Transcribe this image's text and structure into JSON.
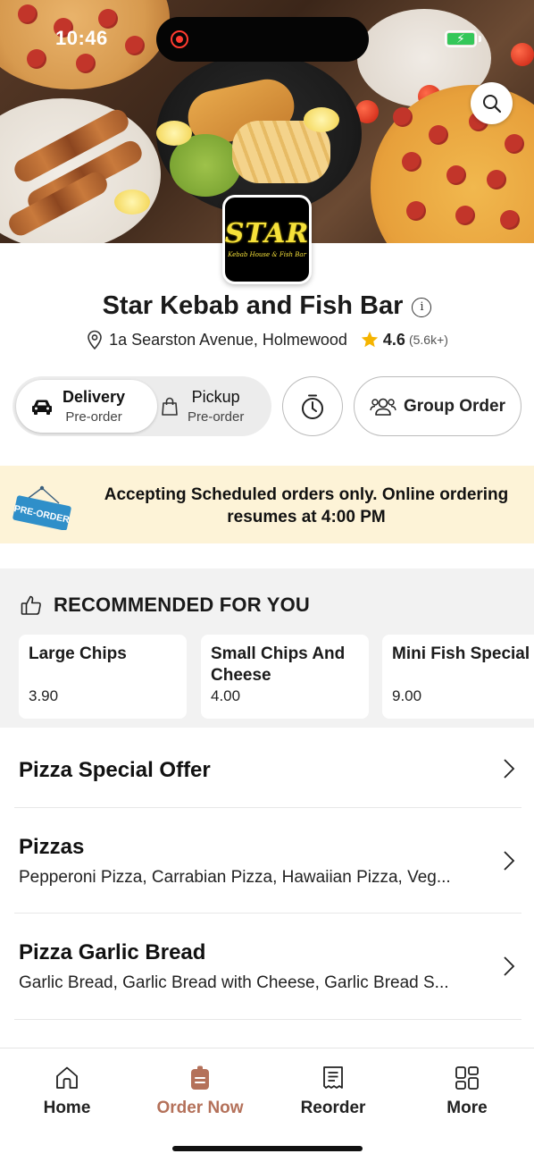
{
  "status_bar": {
    "time": "10:46"
  },
  "restaurant": {
    "logo_text": "STAR",
    "logo_tagline": "Kebab House & Fish Bar",
    "name": "Star Kebab and Fish Bar",
    "address": "1a Searston Avenue, Holmewood",
    "rating": "4.6",
    "rating_count": "(5.6k+)"
  },
  "order_mode": {
    "delivery": {
      "label": "Delivery",
      "sub": "Pre-order",
      "selected": true
    },
    "pickup": {
      "label": "Pickup",
      "sub": "Pre-order",
      "selected": false
    },
    "group_order_label": "Group Order"
  },
  "banner": {
    "tag": "PRE-ORDER",
    "message": "Accepting Scheduled orders only. Online ordering resumes at 4:00 PM"
  },
  "recommended": {
    "title": "RECOMMENDED FOR YOU",
    "items": [
      {
        "name": "Large Chips",
        "price": "3.90"
      },
      {
        "name": "Small Chips And Cheese",
        "price": "4.00"
      },
      {
        "name": "Mini Fish Special",
        "price": "9.00"
      }
    ]
  },
  "categories": [
    {
      "name": "Pizza Special Offer",
      "desc": ""
    },
    {
      "name": "Pizzas",
      "desc": "Pepperoni Pizza, Carrabian Pizza, Hawaiian Pizza, Veg..."
    },
    {
      "name": "Pizza Garlic Bread",
      "desc": "Garlic Bread, Garlic Bread with Cheese, Garlic Bread S..."
    }
  ],
  "bottom_nav": [
    {
      "label": "Home",
      "icon": "home-icon",
      "active": false
    },
    {
      "label": "Order Now",
      "icon": "order-icon",
      "active": true
    },
    {
      "label": "Reorder",
      "icon": "receipt-icon",
      "active": false
    },
    {
      "label": "More",
      "icon": "grid-icon",
      "active": false
    }
  ],
  "colors": {
    "accent": "#b4715a",
    "banner_bg": "#fdf3d7",
    "star": "#f5b400",
    "battery": "#34c759",
    "tag_blue": "#2f8fc9"
  }
}
